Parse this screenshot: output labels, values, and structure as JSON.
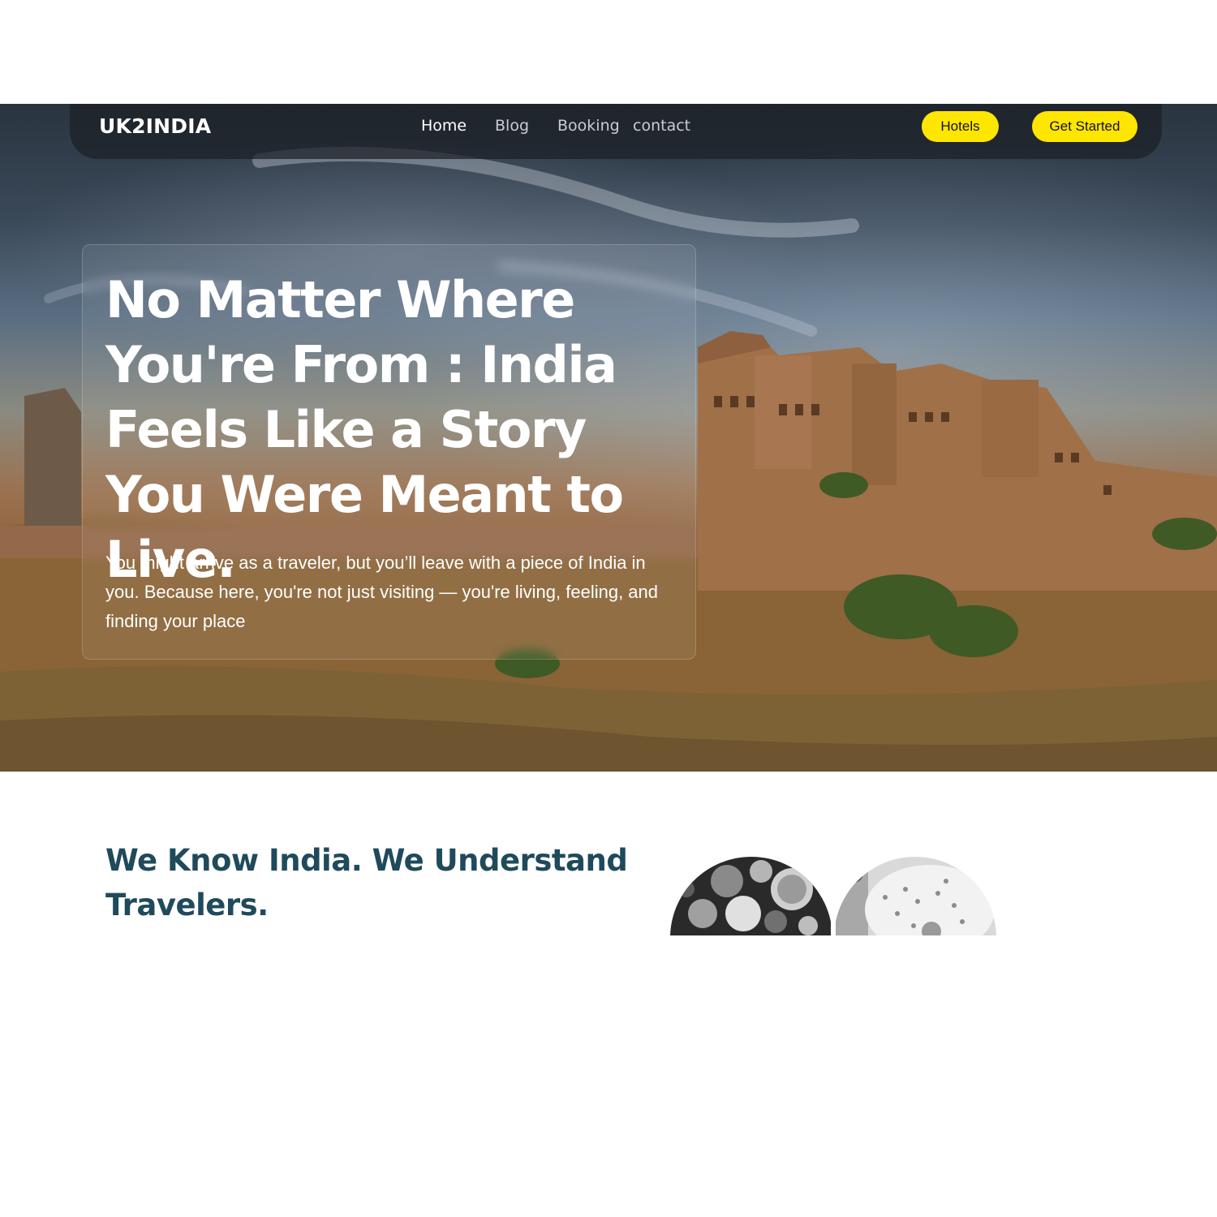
{
  "navbar": {
    "logo": "UK2INDIA",
    "links": [
      {
        "label": "Home",
        "active": true
      },
      {
        "label": "Blog",
        "active": false
      },
      {
        "label": "Booking",
        "active": false
      },
      {
        "label": "contact",
        "active": false
      }
    ],
    "hotels_button": "Hotels",
    "get_started_button": "Get Started"
  },
  "hero": {
    "title": "No Matter Where You're From : India Feels Like a Story You Were Meant to Live.",
    "subtitle": "You might arrive as a traveler, but you’ll leave with a piece of India in you. Because here, you're not just visiting — you're living, feeling, and finding your place"
  },
  "intro": {
    "title": "We Know India. We Understand Travelers."
  },
  "colors": {
    "accent": "#ffe600",
    "heading": "#1f4a5c"
  }
}
